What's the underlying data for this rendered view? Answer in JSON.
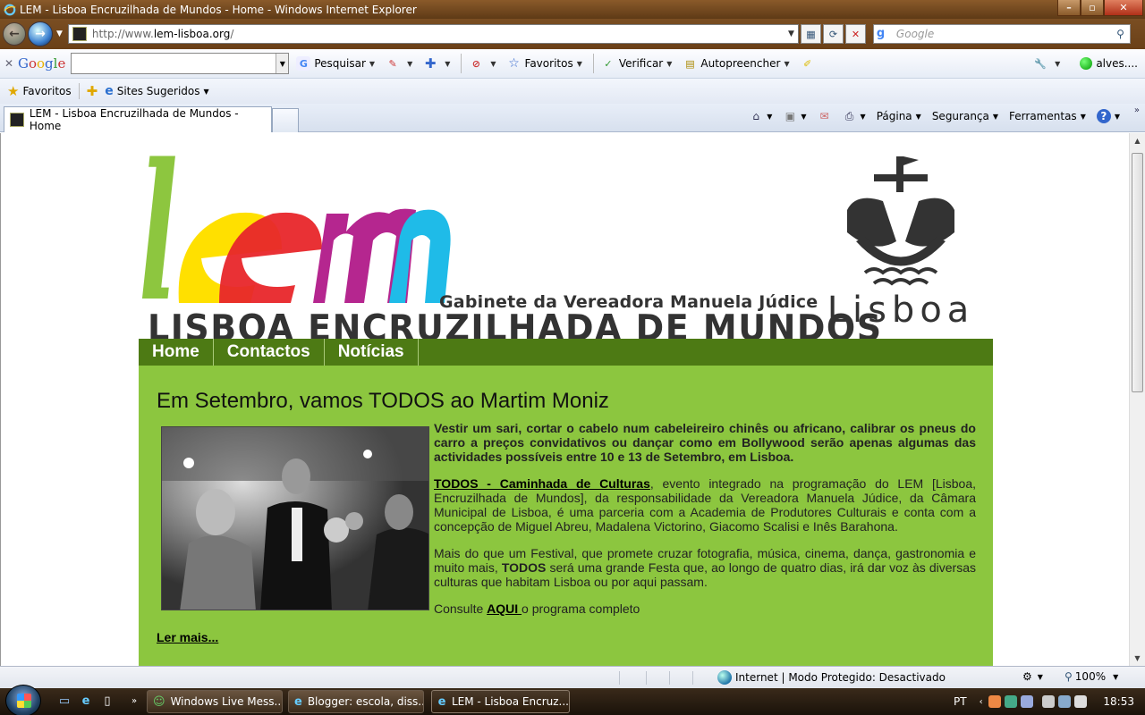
{
  "window": {
    "title": "LEM - Lisboa Encruzilhada de Mundos - Home - Windows Internet Explorer",
    "minimize": "–",
    "maximize": "▫",
    "close": "✕"
  },
  "address": {
    "url_prefix": "http://www.",
    "url_domain": "lem-lisboa.org",
    "url_suffix": "/",
    "search_placeholder": "Google"
  },
  "google_toolbar": {
    "close": "✕",
    "logo": [
      "G",
      "o",
      "o",
      "g",
      "l",
      "e"
    ],
    "search_label": "Pesquisar",
    "favorites_label": "Favoritos",
    "check_label": "Verificar",
    "autofill_label": "Autopreencher",
    "user_label": "alves...."
  },
  "favorites_bar": {
    "favorites": "Favoritos",
    "suggested": "Sites Sugeridos"
  },
  "tab": {
    "title": "LEM - Lisboa Encruzilhada de Mundos - Home"
  },
  "command_bar": {
    "page": "Página",
    "security": "Segurança",
    "tools": "Ferramentas",
    "help": "?"
  },
  "site": {
    "logo_text": "lem",
    "subtitle": "Gabinete da Vereadora Manuela Júdice",
    "title": "LISBOA ENCRUZILHADA DE MUNDOS",
    "emblem_text": "Lisboa",
    "colors": {
      "nav": "#4d7a14",
      "main": "#8cc63f",
      "logo_l": "#8dc63f",
      "logo_e_yellow": "#ffe000",
      "logo_e_red": "#e8262a",
      "logo_m_magenta": "#b5268f",
      "logo_m_cyan": "#1fbbe8"
    },
    "nav": [
      "Home",
      "Contactos",
      "Notícias"
    ],
    "headline": "Em Setembro, vamos TODOS ao Martim Moniz",
    "lead": "Vestir um sari, cortar o cabelo num cabeleireiro chinês ou africano, calibrar os pneus do carro a preços convidativos ou dançar como em Bollywood serão apenas algumas das actividades possíveis entre 10 e 13 de Setembro, em Lisboa.",
    "p2_link": "TODOS - Caminhada de Culturas",
    "p2_text": ", evento integrado na programação do LEM [Lisboa, Encruzilhada de Mundos], da responsabilidade da Vereadora Manuela Júdice, da Câmara Municipal de Lisboa, é uma parceria com a Academia de Produtores Culturais e conta com a concepção de Miguel Abreu, Madalena Victorino, Giacomo Scalisi e Inês Barahona.",
    "p3_a": "Mais do que um Festival, que promete cruzar fotografia, música, cinema, dança, gastronomia e muito mais, ",
    "p3_bold": "TODOS",
    "p3_b": " será uma grande Festa que, ao longo de quatro dias, irá dar voz às diversas culturas que habitam Lisboa ou por aqui passam.",
    "p4_a": "Consulte ",
    "p4_link": "AQUI ",
    "p4_b": "o programa completo",
    "read_more": "Ler mais..."
  },
  "status": {
    "zone": "Internet | Modo Protegido: Desactivado",
    "zoom": "100%"
  },
  "taskbar": {
    "tasks": [
      "Windows Live Mess...",
      "Blogger: escola, diss...",
      "LEM - Lisboa Encruz..."
    ],
    "lang": "PT",
    "time": "18:53"
  }
}
